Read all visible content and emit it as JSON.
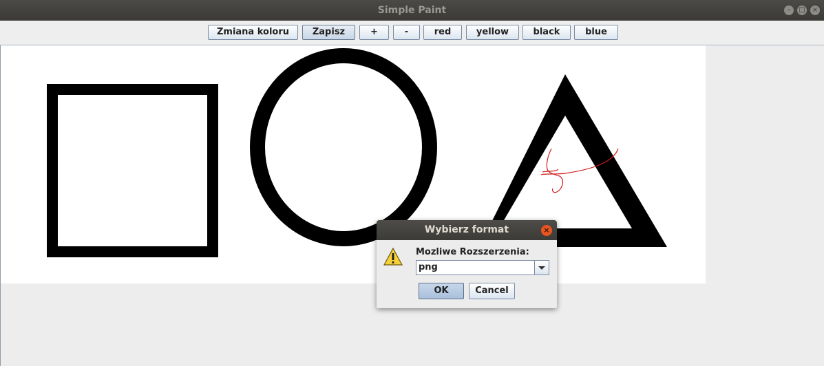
{
  "window": {
    "title": "Simple Paint"
  },
  "toolbar": {
    "buttons": [
      {
        "label": "Zmiana koloru"
      },
      {
        "label": "Zapisz"
      },
      {
        "label": "+"
      },
      {
        "label": "-"
      },
      {
        "label": "red"
      },
      {
        "label": "yellow"
      },
      {
        "label": "black"
      },
      {
        "label": "blue"
      }
    ]
  },
  "canvas": {
    "shapes": [
      "square-outline",
      "circle-outline",
      "triangle-outline",
      "red-freehand-scribble"
    ],
    "stroke_color": "#000000",
    "scribble_color": "#d11a1a"
  },
  "dialog": {
    "title": "Wybierz format",
    "label": "Mozliwe Rozszerzenia:",
    "format_value": "png",
    "ok_label": "OK",
    "cancel_label": "Cancel",
    "icon": "warning-icon"
  }
}
